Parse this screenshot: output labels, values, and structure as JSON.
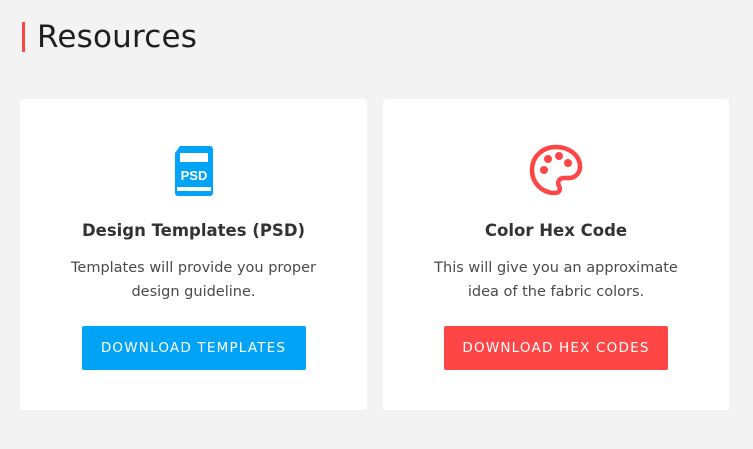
{
  "section": {
    "title": "Resources"
  },
  "cards": [
    {
      "icon": "psd-file-icon",
      "psd_text": "PSD",
      "title": "Design Templates (PSD)",
      "description": "Templates will provide you proper design guideline.",
      "button_label": "DOWNLOAD TEMPLATES",
      "accent": "#00a3f5"
    },
    {
      "icon": "palette-icon",
      "title": "Color Hex Code",
      "description": "This will give you an approximate idea of the fabric colors.",
      "button_label": "DOWNLOAD HEX CODES",
      "accent": "#ff4646"
    }
  ]
}
